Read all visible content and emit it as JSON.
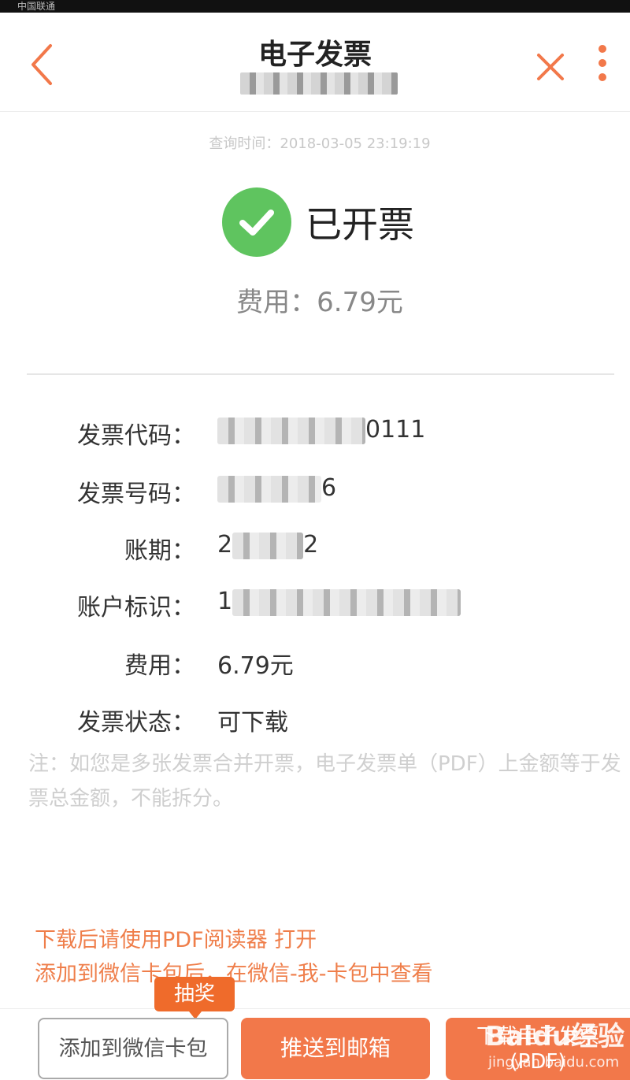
{
  "status_bar": {
    "carrier": "中国联通"
  },
  "header": {
    "title": "电子发票",
    "back_icon": "chevron-left-icon",
    "close_icon": "close-icon",
    "more_icon": "more-vertical-icon",
    "accent_color": "#f2784a"
  },
  "invoice": {
    "query_time": "查询时间：2018-03-05 23:19:19",
    "status": "已开票",
    "status_icon": "check-circle-icon",
    "status_color": "#5fc45f",
    "fee_summary": "费用：6.79元"
  },
  "details": [
    {
      "label": "发票代码：",
      "value_end": "0111"
    },
    {
      "label": "发票号码：",
      "value_end": "6"
    },
    {
      "label": "账期：",
      "value_start": "2",
      "value_end": "2"
    },
    {
      "label": "账户标识：",
      "value_start": "1"
    },
    {
      "label": "费用：",
      "value": "6.79元"
    },
    {
      "label": "发票状态：",
      "value": "可下载"
    }
  ],
  "note": "注：如您是多张发票合并开票，电子发票单（PDF）上金额等于发票总金额，不能拆分。",
  "tips": [
    "下载后请使用PDF阅读器 打开",
    "添加到微信卡包后，在微信-我-卡包中查看"
  ],
  "actions": {
    "lottery_badge": "抽奖",
    "wechat_button": "添加到微信卡包",
    "email_button": "推送到邮箱",
    "download_button_line1": "下载电子发票",
    "download_button_line2": "(PDF)"
  },
  "watermark": {
    "brand": "Baidu经验",
    "url": "jingyan.baidu.com"
  }
}
